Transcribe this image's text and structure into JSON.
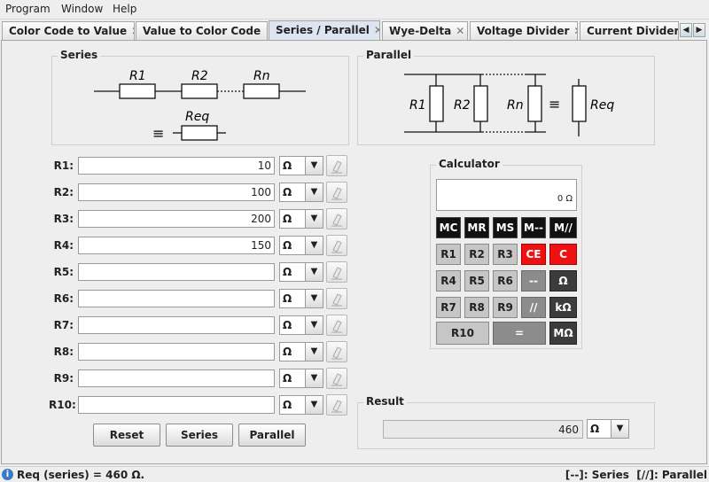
{
  "menu": [
    "Program",
    "Window",
    "Help"
  ],
  "tabs": [
    {
      "label": "Color Code to Value",
      "active": false
    },
    {
      "label": "Value to Color Code",
      "active": false
    },
    {
      "label": "Series / Parallel",
      "active": true
    },
    {
      "label": "Wye-Delta",
      "active": false
    },
    {
      "label": "Voltage Divider",
      "active": false
    },
    {
      "label": "Current Divider",
      "active": false
    }
  ],
  "tab_close": "✕",
  "series": {
    "title": "Series",
    "labels": [
      "R1",
      "R2",
      "Rn",
      "Req"
    ],
    "equiv": "≡"
  },
  "parallel": {
    "title": "Parallel",
    "labels": [
      "R1",
      "R2",
      "Rn",
      "Req"
    ],
    "equiv": "≡"
  },
  "resistors": [
    {
      "label": "R1:",
      "value": "10",
      "unit": "Ω"
    },
    {
      "label": "R2:",
      "value": "100",
      "unit": "Ω"
    },
    {
      "label": "R3:",
      "value": "200",
      "unit": "Ω"
    },
    {
      "label": "R4:",
      "value": "150",
      "unit": "Ω"
    },
    {
      "label": "R5:",
      "value": "",
      "unit": "Ω"
    },
    {
      "label": "R6:",
      "value": "",
      "unit": "Ω"
    },
    {
      "label": "R7:",
      "value": "",
      "unit": "Ω"
    },
    {
      "label": "R8:",
      "value": "",
      "unit": "Ω"
    },
    {
      "label": "R9:",
      "value": "",
      "unit": "Ω"
    },
    {
      "label": "R10:",
      "value": "",
      "unit": "Ω"
    }
  ],
  "buttons": {
    "reset": "Reset",
    "series": "Series",
    "parallel": "Parallel"
  },
  "calculator": {
    "title": "Calculator",
    "display": "0 Ω",
    "rows": [
      [
        {
          "label": "MC",
          "style": "black"
        },
        {
          "label": "MR",
          "style": "black"
        },
        {
          "label": "MS",
          "style": "black"
        },
        {
          "label": "M--",
          "style": "black"
        },
        {
          "label": "M//",
          "style": "black"
        }
      ],
      [
        {
          "label": "R1",
          "style": "gray"
        },
        {
          "label": "R2",
          "style": "gray"
        },
        {
          "label": "R3",
          "style": "gray"
        },
        {
          "label": "CE",
          "style": "red"
        },
        {
          "label": "C",
          "style": "red"
        }
      ],
      [
        {
          "label": "R4",
          "style": "gray"
        },
        {
          "label": "R5",
          "style": "gray"
        },
        {
          "label": "R6",
          "style": "gray"
        },
        {
          "label": "--",
          "style": "dgray"
        },
        {
          "label": "Ω",
          "style": "dark"
        }
      ],
      [
        {
          "label": "R7",
          "style": "gray"
        },
        {
          "label": "R8",
          "style": "gray"
        },
        {
          "label": "R9",
          "style": "gray"
        },
        {
          "label": "//",
          "style": "dgray"
        },
        {
          "label": "kΩ",
          "style": "dark"
        }
      ]
    ],
    "last_row": {
      "r10": "R10",
      "equals": "=",
      "mohm": "MΩ"
    }
  },
  "result": {
    "title": "Result",
    "value": "460",
    "unit": "Ω"
  },
  "status": {
    "left": "Req (series) = 460 Ω.",
    "right": "[--]: Series  [//]: Parallel"
  },
  "colors": {
    "accent": "#dde6f0",
    "red": "#ee1111",
    "black": "#111111"
  }
}
